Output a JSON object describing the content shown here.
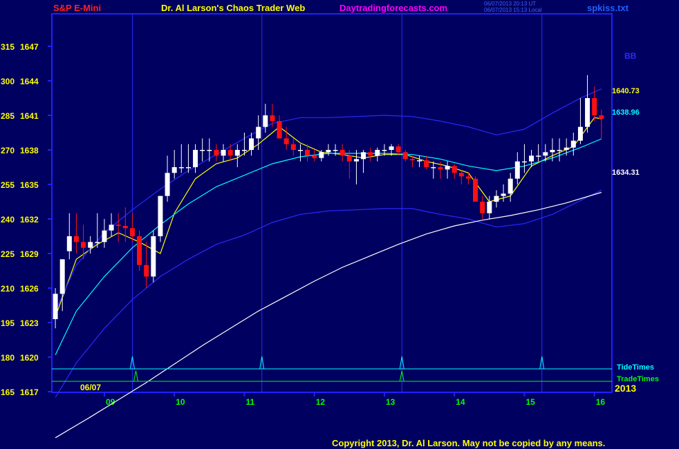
{
  "header": {
    "symbol": "S&P E-Mini",
    "site_title": "Dr. Al Larson's Chaos Trader Web",
    "website": "Daytradingforecasts.com",
    "timestamp_ut": "06/07/2013 20:13 UT",
    "timestamp_local": "06/07/2013 15:13 Local",
    "file": "spkiss.txt"
  },
  "footer": {
    "copyright": "Copyright 2013, Dr. Al Larson. May not be copied by any means."
  },
  "colors": {
    "background": "#000060",
    "frame": "#2020ff",
    "bull_candle": "#ffffff",
    "bear_candle": "#ff1010",
    "yellow": "#ffff00",
    "cyan": "#00ffff",
    "green": "#00ff00",
    "magenta": "#ff00ff",
    "red_title": "#ff2020"
  },
  "chart_data": {
    "type": "candlestick",
    "date_label": "06/07",
    "year_label": "2013",
    "x_hours": [
      9,
      10,
      11,
      12,
      13,
      14,
      15,
      16
    ],
    "x_tick_labels": [
      "09",
      "10",
      "11",
      "12",
      "13",
      "14",
      "15",
      "16"
    ],
    "x_range": [
      8.25,
      16.25
    ],
    "y_left_ticks": [
      165,
      180,
      195,
      210,
      225,
      240,
      255,
      270,
      285,
      300,
      315
    ],
    "y_price_ticks": [
      1617,
      1620,
      1623,
      1626,
      1629,
      1632,
      1635,
      1638,
      1641,
      1644,
      1647
    ],
    "y_range": [
      1617,
      1647
    ],
    "vertical_time_lines": [
      9.4,
      11.25,
      13.25,
      15.25
    ],
    "tide_times": [
      9.4,
      11.25,
      13.25,
      15.25
    ],
    "trade_times": [
      9.45,
      13.25
    ],
    "lower_panel_labels": [
      "TideTimes",
      "TradeTimes"
    ],
    "band_label": "BB",
    "price_labels": [
      {
        "value": "1640.73",
        "color": "yellow"
      },
      {
        "value": "1638.96",
        "color": "cyan"
      },
      {
        "value": "1634.31",
        "color": "white"
      }
    ],
    "series": [
      {
        "type": "candlestick",
        "x": [
          8.3,
          8.4,
          8.5,
          8.6,
          8.7,
          8.8,
          8.9,
          9.0,
          9.1,
          9.2,
          9.3,
          9.4,
          9.5,
          9.6,
          9.7,
          9.8,
          9.9,
          10.0,
          10.1,
          10.2,
          10.3,
          10.4,
          10.5,
          10.6,
          10.7,
          10.8,
          10.9,
          11.0,
          11.1,
          11.2,
          11.3,
          11.4,
          11.5,
          11.6,
          11.7,
          11.8,
          11.9,
          12.0,
          12.1,
          12.2,
          12.3,
          12.4,
          12.5,
          12.6,
          12.7,
          12.8,
          12.9,
          13.0,
          13.1,
          13.2,
          13.3,
          13.4,
          13.5,
          13.6,
          13.7,
          13.8,
          13.9,
          14.0,
          14.1,
          14.2,
          14.3,
          14.4,
          14.5,
          14.6,
          14.7,
          14.8,
          14.9,
          15.0,
          15.1,
          15.2,
          15.3,
          15.4,
          15.5,
          15.6,
          15.7,
          15.8,
          15.9,
          16.0,
          16.1
        ],
        "open": [
          1623.3,
          1625.5,
          1629.2,
          1630.5,
          1630.0,
          1629.5,
          1630.0,
          1630.0,
          1631.0,
          1631.5,
          1631.4,
          1631.2,
          1630.5,
          1628.0,
          1627.0,
          1630.5,
          1634.0,
          1636.0,
          1636.5,
          1636.5,
          1636.5,
          1638.0,
          1638.0,
          1638.0,
          1637.5,
          1638.0,
          1637.5,
          1638.0,
          1638.0,
          1639.0,
          1640.0,
          1641.0,
          1640.5,
          1639.0,
          1638.5,
          1638.0,
          1638.0,
          1637.5,
          1637.3,
          1637.8,
          1638.0,
          1638.0,
          1637.5,
          1637.0,
          1637.2,
          1637.8,
          1637.5,
          1638.0,
          1638.0,
          1638.3,
          1637.8,
          1637.2,
          1637.1,
          1637.1,
          1636.5,
          1636.5,
          1636.3,
          1636.6,
          1636.0,
          1635.7,
          1635.5,
          1633.5,
          1632.5,
          1633.5,
          1634.0,
          1634.2,
          1635.5,
          1637.0,
          1637.0,
          1637.5,
          1637.5,
          1637.8,
          1638.0,
          1638.0,
          1638.2,
          1638.8,
          1640.0,
          1642.5,
          1641.0
        ],
        "high": [
          1626.0,
          1628.5,
          1632.5,
          1632.5,
          1631.5,
          1630.5,
          1632.5,
          1632.0,
          1632.5,
          1632.5,
          1633.0,
          1632.5,
          1631.0,
          1630.0,
          1631.0,
          1634.0,
          1637.5,
          1638.0,
          1638.5,
          1638.5,
          1638.5,
          1639.0,
          1639.0,
          1638.5,
          1638.5,
          1638.5,
          1638.5,
          1639.5,
          1639.5,
          1641.0,
          1642.0,
          1642.0,
          1641.0,
          1640.0,
          1639.0,
          1638.5,
          1638.5,
          1638.0,
          1638.0,
          1638.5,
          1638.5,
          1638.5,
          1638.0,
          1638.0,
          1638.0,
          1638.2,
          1638.2,
          1638.5,
          1638.5,
          1638.5,
          1638.0,
          1637.5,
          1637.5,
          1637.5,
          1637.0,
          1637.0,
          1637.0,
          1636.8,
          1636.2,
          1636.0,
          1635.7,
          1634.0,
          1634.0,
          1634.5,
          1635.0,
          1636.0,
          1637.8,
          1638.5,
          1638.0,
          1638.5,
          1638.5,
          1639.0,
          1639.0,
          1639.0,
          1639.5,
          1642.5,
          1644.5,
          1643.5,
          1641.5
        ],
        "low": [
          1622.5,
          1624.0,
          1628.5,
          1629.0,
          1628.5,
          1629.0,
          1629.5,
          1629.5,
          1630.5,
          1630.0,
          1630.0,
          1630.0,
          1627.5,
          1626.0,
          1626.5,
          1630.0,
          1633.5,
          1635.5,
          1636.0,
          1636.0,
          1636.0,
          1637.0,
          1637.0,
          1637.0,
          1637.0,
          1637.0,
          1636.5,
          1637.5,
          1637.5,
          1638.0,
          1639.5,
          1640.0,
          1639.0,
          1638.0,
          1637.5,
          1637.0,
          1637.0,
          1637.0,
          1637.0,
          1637.5,
          1637.5,
          1637.0,
          1635.5,
          1635.0,
          1636.0,
          1637.0,
          1637.0,
          1637.5,
          1637.5,
          1637.5,
          1637.0,
          1636.5,
          1636.5,
          1636.3,
          1635.5,
          1635.5,
          1635.5,
          1635.5,
          1635.0,
          1635.0,
          1633.5,
          1632.0,
          1632.0,
          1633.0,
          1633.5,
          1633.5,
          1635.0,
          1636.0,
          1636.5,
          1637.0,
          1637.0,
          1637.0,
          1637.0,
          1637.5,
          1637.5,
          1638.5,
          1639.5,
          1640.5,
          1639.0
        ],
        "close": [
          1625.5,
          1628.5,
          1630.5,
          1630.0,
          1629.5,
          1630.0,
          1630.0,
          1631.0,
          1631.5,
          1631.4,
          1631.2,
          1630.5,
          1628.0,
          1627.0,
          1630.5,
          1634.0,
          1636.0,
          1636.5,
          1636.5,
          1636.5,
          1638.0,
          1638.0,
          1638.0,
          1637.5,
          1638.0,
          1637.5,
          1638.0,
          1638.0,
          1639.0,
          1640.0,
          1641.0,
          1640.5,
          1639.0,
          1638.5,
          1638.0,
          1638.0,
          1637.5,
          1637.3,
          1637.8,
          1638.0,
          1638.0,
          1637.5,
          1637.0,
          1637.2,
          1637.8,
          1637.5,
          1638.0,
          1638.0,
          1638.3,
          1637.8,
          1637.2,
          1637.1,
          1637.1,
          1636.5,
          1636.5,
          1636.3,
          1636.6,
          1636.0,
          1635.7,
          1635.5,
          1633.5,
          1632.5,
          1633.5,
          1634.0,
          1634.2,
          1635.5,
          1637.0,
          1637.0,
          1637.5,
          1637.5,
          1637.8,
          1638.0,
          1638.0,
          1638.2,
          1638.8,
          1640.0,
          1642.5,
          1641.0,
          1640.7
        ]
      },
      {
        "type": "line",
        "color": "yellow",
        "x": [
          8.3,
          8.6,
          8.9,
          9.2,
          9.5,
          9.8,
          10.0,
          10.3,
          10.6,
          10.9,
          11.2,
          11.5,
          11.8,
          12.1,
          12.4,
          12.7,
          13.0,
          13.3,
          13.6,
          13.9,
          14.2,
          14.5,
          14.8,
          15.1,
          15.4,
          15.7,
          16.0,
          16.1
        ],
        "y": [
          1623.5,
          1628.5,
          1629.8,
          1630.8,
          1630.0,
          1629.0,
          1632.5,
          1635.5,
          1636.8,
          1637.3,
          1638.5,
          1640.0,
          1638.6,
          1637.8,
          1637.6,
          1637.3,
          1637.6,
          1637.6,
          1637.0,
          1636.6,
          1636.0,
          1633.5,
          1634.0,
          1636.6,
          1637.5,
          1638.3,
          1640.8,
          1640.7
        ]
      },
      {
        "type": "line",
        "color": "cyan",
        "x": [
          8.3,
          8.6,
          9.0,
          9.4,
          9.8,
          10.2,
          10.6,
          11.0,
          11.4,
          11.8,
          12.2,
          12.6,
          13.0,
          13.4,
          13.8,
          14.2,
          14.6,
          15.0,
          15.4,
          15.8,
          16.1
        ],
        "y": [
          1620.2,
          1624.0,
          1627.0,
          1629.5,
          1631.5,
          1633.3,
          1634.8,
          1635.8,
          1636.8,
          1637.4,
          1637.7,
          1637.7,
          1637.7,
          1637.6,
          1637.2,
          1636.6,
          1636.2,
          1636.6,
          1637.3,
          1638.2,
          1638.96
        ]
      },
      {
        "type": "line",
        "color": "blue",
        "name": "BB upper",
        "x": [
          8.3,
          8.6,
          9.0,
          9.4,
          9.8,
          10.2,
          10.6,
          11.0,
          11.4,
          11.8,
          12.2,
          12.6,
          13.0,
          13.4,
          13.8,
          14.2,
          14.6,
          15.0,
          15.4,
          15.8,
          16.1
        ],
        "y": [
          1624.0,
          1628.0,
          1630.8,
          1632.8,
          1634.6,
          1636.2,
          1637.6,
          1639.0,
          1640.3,
          1640.8,
          1640.8,
          1640.9,
          1641.0,
          1640.9,
          1640.5,
          1640.0,
          1639.3,
          1639.8,
          1641.2,
          1642.5,
          1643.3
        ]
      },
      {
        "type": "line",
        "color": "blue",
        "name": "BB lower",
        "x": [
          8.3,
          8.6,
          9.0,
          9.4,
          9.8,
          10.2,
          10.6,
          11.0,
          11.4,
          11.8,
          12.2,
          12.6,
          13.0,
          13.4,
          13.8,
          14.2,
          14.6,
          15.0,
          15.4,
          15.8,
          16.1
        ],
        "y": [
          1616.5,
          1619.5,
          1622.5,
          1625.0,
          1627.0,
          1628.5,
          1629.8,
          1630.6,
          1631.7,
          1632.4,
          1632.7,
          1632.8,
          1632.9,
          1632.9,
          1632.4,
          1632.0,
          1631.3,
          1631.6,
          1632.4,
          1633.6,
          1634.5
        ]
      },
      {
        "type": "line",
        "color": "white",
        "x": [
          8.3,
          8.8,
          9.2,
          9.6,
          10.0,
          10.4,
          10.8,
          11.2,
          11.6,
          12.0,
          12.4,
          12.8,
          13.2,
          13.6,
          14.0,
          14.4,
          14.8,
          15.2,
          15.6,
          16.1
        ],
        "y": [
          1613.0,
          1614.8,
          1616.3,
          1617.8,
          1619.4,
          1621.0,
          1622.5,
          1624.0,
          1625.3,
          1626.6,
          1627.8,
          1628.8,
          1629.8,
          1630.7,
          1631.4,
          1631.9,
          1632.3,
          1632.8,
          1633.4,
          1634.31
        ]
      }
    ]
  }
}
